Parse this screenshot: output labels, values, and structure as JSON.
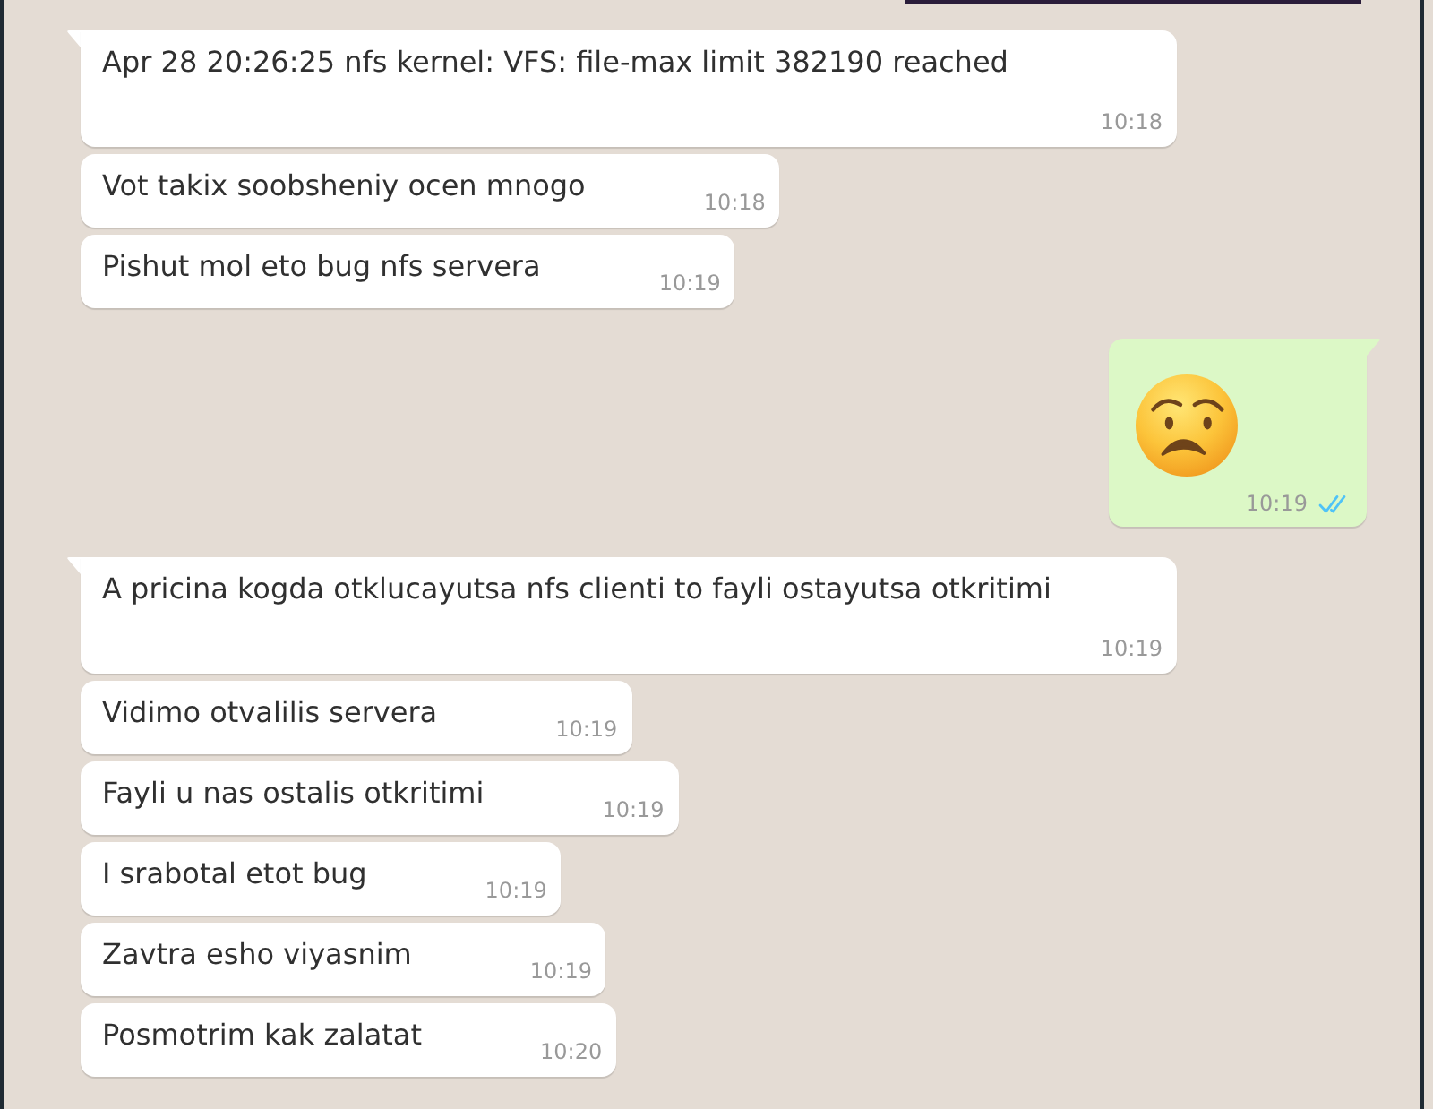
{
  "messages": [
    {
      "outgoing": false,
      "kind": "text",
      "text": "Apr 28 20:26:25 nfs kernel: VFS: file-max limit 382190 reached",
      "time": "10:18"
    },
    {
      "outgoing": false,
      "kind": "text",
      "text": "Vot takix soobsheniy ocen mnogo",
      "time": "10:18"
    },
    {
      "outgoing": false,
      "kind": "text",
      "text": "Pishut mol eto bug nfs servera",
      "time": "10:19"
    },
    {
      "outgoing": true,
      "kind": "emoji",
      "time": "10:19",
      "read": true
    },
    {
      "outgoing": false,
      "kind": "text",
      "text": "A pricina kogda otklucayutsa nfs clienti to fayli ostayutsa otkritimi",
      "time": "10:19"
    },
    {
      "outgoing": false,
      "kind": "text",
      "text": "Vidimo otvalilis servera",
      "time": "10:19"
    },
    {
      "outgoing": false,
      "kind": "text",
      "text": "Fayli u nas ostalis otkritimi",
      "time": "10:19"
    },
    {
      "outgoing": false,
      "kind": "text",
      "text": "I srabotal etot bug",
      "time": "10:19"
    },
    {
      "outgoing": false,
      "kind": "text",
      "text": "Zavtra esho viyasnim",
      "time": "10:19"
    },
    {
      "outgoing": false,
      "kind": "text",
      "text": "Posmotrim kak zalatat",
      "time": "10:20"
    }
  ]
}
